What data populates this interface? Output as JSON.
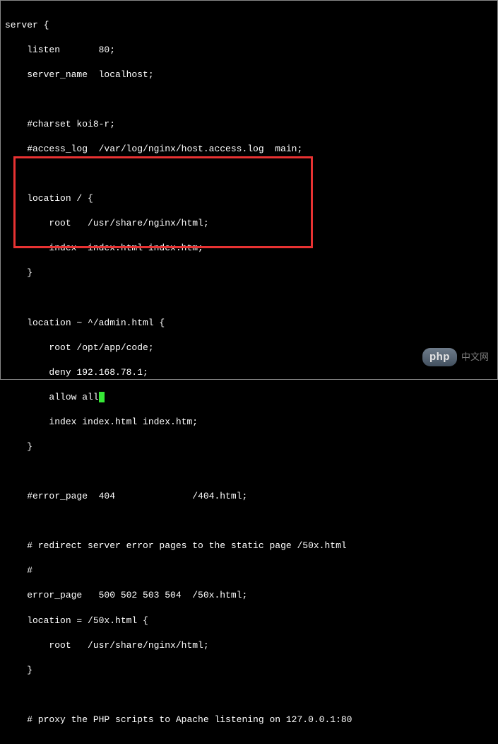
{
  "code": {
    "l01": "server {",
    "l02": "    listen       80;",
    "l03": "    server_name  localhost;",
    "l04": "",
    "l05": "    #charset koi8-r;",
    "l06": "    #access_log  /var/log/nginx/host.access.log  main;",
    "l07": "",
    "l08": "    location / {",
    "l09": "        root   /usr/share/nginx/html;",
    "l10": "        index  index.html index.htm;",
    "l11": "    }",
    "l12": "",
    "l13": "    location ~ ^/admin.html {",
    "l14": "        root /opt/app/code;",
    "l15": "        deny 192.168.78.1;",
    "l16a": "        allow all",
    "l16b": "",
    "l17": "        index index.html index.htm;",
    "l18": "    }",
    "l19": "",
    "l20": "    #error_page  404              /404.html;",
    "l21": "",
    "l22": "    # redirect server error pages to the static page /50x.html",
    "l23": "    #",
    "l24": "    error_page   500 502 503 504  /50x.html;",
    "l25": "    location = /50x.html {",
    "l26": "        root   /usr/share/nginx/html;",
    "l27": "    }",
    "l28": "",
    "l29": "    # proxy the PHP scripts to Apache listening on 127.0.0.1:80"
  },
  "watermark": {
    "badge": "php",
    "text": "中文网"
  }
}
